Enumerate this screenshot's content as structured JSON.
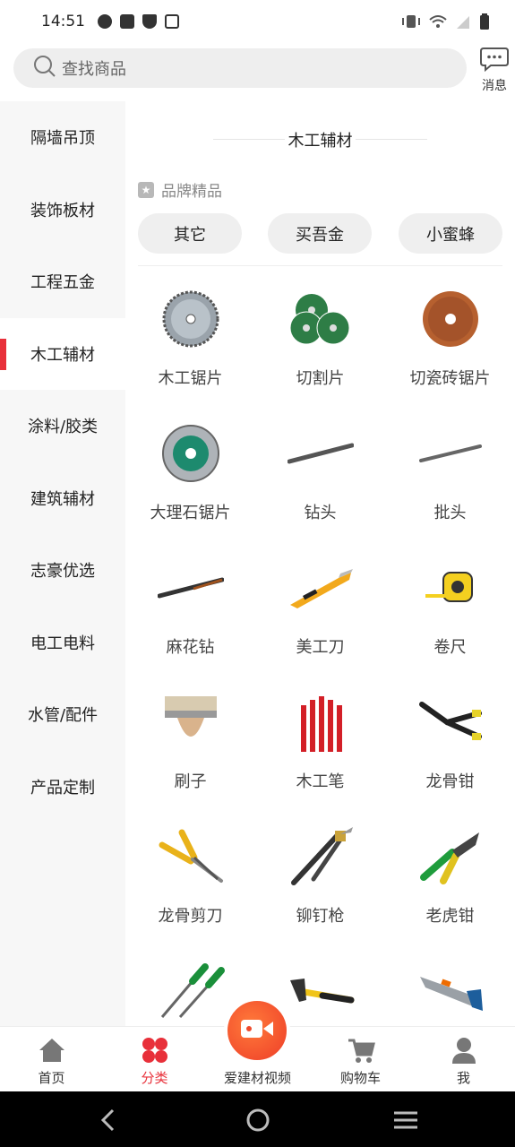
{
  "status_bar": {
    "time": "14:51"
  },
  "search": {
    "placeholder": "查找商品",
    "message_label": "消息"
  },
  "sidebar": {
    "items": [
      {
        "label": "隔墙吊顶",
        "active": false
      },
      {
        "label": "装饰板材",
        "active": false
      },
      {
        "label": "工程五金",
        "active": false
      },
      {
        "label": "木工辅材",
        "active": true
      },
      {
        "label": "涂料/胶类",
        "active": false
      },
      {
        "label": "建筑辅材",
        "active": false
      },
      {
        "label": "志豪优选",
        "active": false
      },
      {
        "label": "电工电料",
        "active": false
      },
      {
        "label": "水管/配件",
        "active": false
      },
      {
        "label": "产品定制",
        "active": false
      }
    ]
  },
  "content": {
    "section_title": "木工辅材",
    "brand_label": "品牌精品",
    "brands": [
      "其它",
      "买吾金",
      "小蜜蜂"
    ],
    "products": [
      {
        "name": "木工锯片",
        "icon": "saw-blade-icon"
      },
      {
        "name": "切割片",
        "icon": "cutting-disc-icon"
      },
      {
        "name": "切瓷砖锯片",
        "icon": "tile-saw-blade-icon"
      },
      {
        "name": "大理石锯片",
        "icon": "marble-blade-icon"
      },
      {
        "name": "钻头",
        "icon": "drill-bit-icon"
      },
      {
        "name": "批头",
        "icon": "screwdriver-bit-icon"
      },
      {
        "name": "麻花钻",
        "icon": "twist-drill-icon"
      },
      {
        "name": "美工刀",
        "icon": "utility-knife-icon"
      },
      {
        "name": "卷尺",
        "icon": "tape-measure-icon"
      },
      {
        "name": "刷子",
        "icon": "brush-icon"
      },
      {
        "name": "木工笔",
        "icon": "carpenter-pencil-icon"
      },
      {
        "name": "龙骨钳",
        "icon": "keel-pliers-icon"
      },
      {
        "name": "龙骨剪刀",
        "icon": "keel-shears-icon"
      },
      {
        "name": "铆钉枪",
        "icon": "rivet-gun-icon"
      },
      {
        "name": "老虎钳",
        "icon": "pliers-icon"
      },
      {
        "name": "",
        "icon": "screwdriver-icon"
      },
      {
        "name": "",
        "icon": "hammer-icon"
      },
      {
        "name": "",
        "icon": "hand-saw-icon"
      }
    ]
  },
  "tabbar": {
    "tabs": [
      {
        "label": "首页",
        "icon": "home-icon",
        "active": false
      },
      {
        "label": "分类",
        "icon": "category-icon",
        "active": true
      },
      {
        "label": "爱建材视频",
        "icon": "video-icon",
        "active": false
      },
      {
        "label": "购物车",
        "icon": "cart-icon",
        "active": false
      },
      {
        "label": "我",
        "icon": "user-icon",
        "active": false
      }
    ]
  },
  "colors": {
    "accent": "#e8303a",
    "video": "#ef4a2c",
    "sidebar_bg": "#f7f7f7",
    "pill_bg": "#efefef"
  }
}
